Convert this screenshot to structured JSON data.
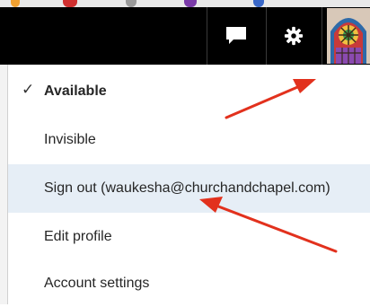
{
  "topbar": {
    "chat_icon": "chat-bubble-icon",
    "settings_icon": "gear-icon",
    "avatar_icon": "stained-glass-avatar"
  },
  "menu": {
    "items": [
      {
        "label": "Available",
        "selected": true
      },
      {
        "label": "Invisible"
      },
      {
        "label": "Sign out (waukesha@churchandchapel.com)",
        "highlighted": true
      },
      {
        "label": "Edit profile"
      },
      {
        "label": "Account settings"
      }
    ],
    "check_glyph": "✓"
  },
  "colors": {
    "topbar": "#000000",
    "highlight": "#e6eef6",
    "annotation_arrow": "#e2311d"
  }
}
